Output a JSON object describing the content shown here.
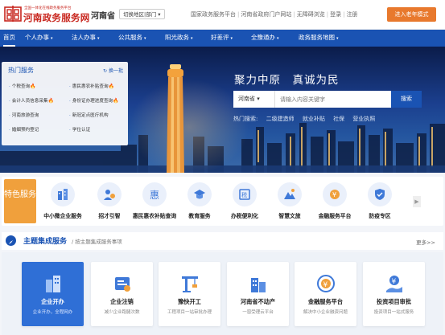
{
  "header": {
    "logo_subtitle": "全国一体化在线政务服务平台",
    "logo_title": "河南政务服务网",
    "province": "河南省",
    "switch_label": "切换地区|部门 ▾",
    "links": [
      "国家政务服务平台",
      "河南省政府门户网站",
      "无障碍浏览",
      "登录",
      "注册"
    ],
    "elder_mode": "进入老年模式"
  },
  "nav": {
    "items": [
      "首页",
      "个人办事",
      "法人办事",
      "公共服务",
      "阳光政务",
      "好差评",
      "全豫通办",
      "政务服务地图"
    ],
    "caret": "▾"
  },
  "hot_services": {
    "title": "热门服务",
    "swap_label": "换一批",
    "items": [
      "个税查询",
      "惠民惠农补贴查询",
      "会计人员信息采集",
      "身份证办理进度查询",
      "河南旅游查询",
      "新冠定点医疗机构",
      "婚姻预约登记",
      "学位认证"
    ],
    "fire_icon": "🔥"
  },
  "hero": {
    "slogan": "聚力中原　真诚为民",
    "search_province": "河南省 ▾",
    "search_placeholder": "请输入内容关键字",
    "search_button": "搜索",
    "hot_search_label": "热门搜索:",
    "hot_search_terms": [
      "二级建造师",
      "就业补贴",
      "社保",
      "营业执照"
    ]
  },
  "feature": {
    "badge": "特色服务",
    "items": [
      {
        "label": "中小微企业服务",
        "icon": "enterprise-icon"
      },
      {
        "label": "招才引智",
        "icon": "talent-icon"
      },
      {
        "label": "惠民惠农补贴查询",
        "icon": "subsidy-icon"
      },
      {
        "label": "教育服务",
        "icon": "education-icon"
      },
      {
        "label": "办税便利化",
        "icon": "tax-icon"
      },
      {
        "label": "智慧文旅",
        "icon": "tourism-icon"
      },
      {
        "label": "金融服务平台",
        "icon": "finance-icon"
      },
      {
        "label": "防疫专区",
        "icon": "shield-icon"
      }
    ],
    "next_arrow": "▶"
  },
  "theme": {
    "title": "主题集成服务",
    "subtitle": "/ 按主题集成服务事项",
    "more": "更多>>",
    "cards": [
      {
        "title": "企业开办",
        "sub": "企业开办，全程网办",
        "icon": "building-icon"
      },
      {
        "title": "企业注销",
        "sub": "减少企业跑腿次数",
        "icon": "cancel-icon"
      },
      {
        "title": "豫快开工",
        "sub": "工程项目一站审批办理",
        "icon": "crane-icon"
      },
      {
        "title": "河南省不动产",
        "sub": "一窗受理云平台",
        "icon": "realestate-icon"
      },
      {
        "title": "金融服务平台",
        "sub": "解决中小企业融资问题",
        "icon": "finance-icon"
      },
      {
        "title": "投资项目审批",
        "sub": "投资项目一站式服务",
        "icon": "investment-icon"
      }
    ]
  },
  "colors": {
    "primary": "#1a53b3",
    "brand_red": "#c8261e",
    "elder_orange": "#e8792d",
    "feature_orange": "#f0a03c"
  }
}
